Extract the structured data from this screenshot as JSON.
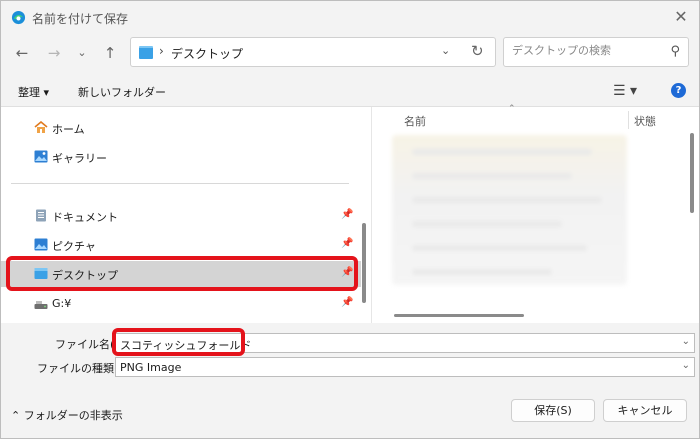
{
  "window": {
    "title": "名前を付けて保存"
  },
  "nav": {
    "address_path": "デスクトップ",
    "search_placeholder": "デスクトップの検索"
  },
  "toolbar": {
    "organize_label": "整理 ▾",
    "new_folder_label": "新しいフォルダー"
  },
  "sidebar": {
    "items": [
      {
        "label": "ホーム",
        "icon": "home-icon"
      },
      {
        "label": "ギャラリー",
        "icon": "gallery-icon"
      },
      {
        "label": "ドキュメント",
        "icon": "document-icon",
        "pinned": true
      },
      {
        "label": "ピクチャ",
        "icon": "picture-icon",
        "pinned": true
      },
      {
        "label": "デスクトップ",
        "icon": "desktop-folder-icon",
        "pinned": true,
        "selected": true
      },
      {
        "label": "G:¥",
        "icon": "drive-icon",
        "pinned": true
      }
    ]
  },
  "files": {
    "columns": [
      "名前",
      "状態"
    ]
  },
  "form": {
    "filename_label": "ファイル名(N):",
    "filename_value": "スコティッシュフォールド",
    "filetype_label": "ファイルの種類(T):",
    "filetype_value": "PNG Image"
  },
  "footer": {
    "toggle_folders_label": "フォルダーの非表示",
    "save_label": "保存(S)",
    "cancel_label": "キャンセル"
  },
  "colors": {
    "highlight": "#e4131b",
    "folder": "#3aa1e6",
    "help": "#1e6ad6"
  }
}
